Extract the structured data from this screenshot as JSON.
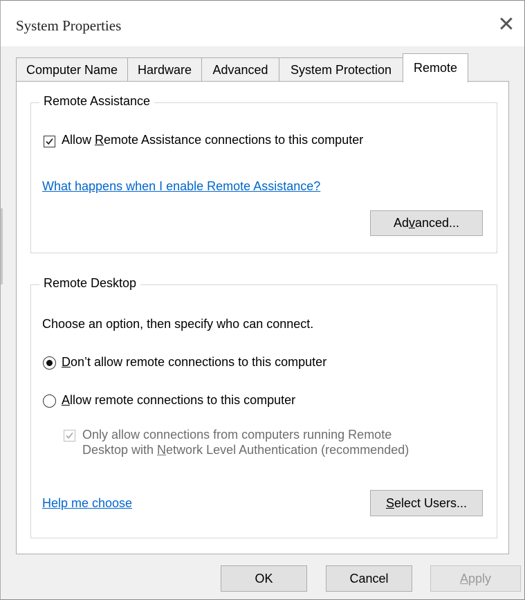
{
  "window": {
    "title": "System Properties",
    "close_symbol": "✕"
  },
  "tabs": [
    {
      "label": "Computer Name",
      "active": false
    },
    {
      "label": "Hardware",
      "active": false
    },
    {
      "label": "Advanced",
      "active": false
    },
    {
      "label": "System Protection",
      "active": false
    },
    {
      "label": "Remote",
      "active": true
    }
  ],
  "remote_assistance": {
    "group_label": "Remote Assistance",
    "allow_checkbox": {
      "checked": true,
      "label_pre": "Allow ",
      "label_mnemonic": "R",
      "label_post": "emote Assistance connections to this computer"
    },
    "help_link": "What happens when I enable Remote Assistance?",
    "advanced_button": {
      "pre": "Ad",
      "mnemonic": "v",
      "post": "anced..."
    }
  },
  "remote_desktop": {
    "group_label": "Remote Desktop",
    "instruction": "Choose an option, then specify who can connect.",
    "option_dont_allow": {
      "selected": true,
      "mnemonic": "D",
      "post": "on’t allow remote connections to this computer"
    },
    "option_allow": {
      "selected": false,
      "mnemonic": "A",
      "post": "llow remote connections to this computer"
    },
    "nla_checkbox": {
      "checked": true,
      "enabled": false,
      "line1": "Only allow connections from computers running Remote",
      "line2_pre": "Desktop with ",
      "line2_mnemonic": "N",
      "line2_post": "etwork Level Authentication (recommended)"
    },
    "help_link": "Help me choose",
    "select_users_button": {
      "mnemonic": "S",
      "post": "elect Users..."
    }
  },
  "footer": {
    "ok": "OK",
    "cancel": "Cancel",
    "apply_mnemonic": "A",
    "apply_post": "pply"
  },
  "colors": {
    "link": "#0066cc",
    "dialog_bg": "#f0f0f0",
    "panel_bg": "#ffffff"
  },
  "icons": [
    "close-icon",
    "checkmark-icon",
    "radio-dot-icon"
  ]
}
